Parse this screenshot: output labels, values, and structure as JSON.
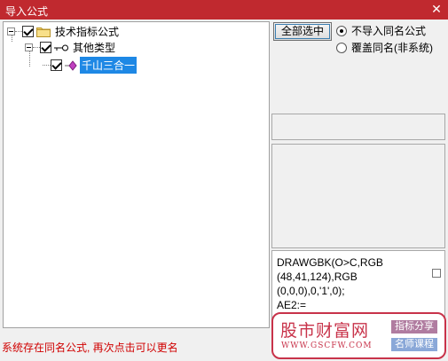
{
  "window": {
    "title": "导入公式",
    "close_glyph": "✕"
  },
  "tree": {
    "root": {
      "label": "技术指标公式",
      "checked": true,
      "icon": "folder-icon"
    },
    "child": {
      "label": "其他类型",
      "checked": true,
      "icon": "key-icon"
    },
    "leaf": {
      "label": "千山三合一",
      "checked": true,
      "selected": true,
      "icon": "formula-diamond-icon"
    }
  },
  "controls": {
    "select_all_label": "全部选中",
    "options": [
      {
        "label": "不导入同名公式",
        "selected": true
      },
      {
        "label": "覆盖同名(非系统)",
        "selected": false
      }
    ]
  },
  "code": {
    "lines": [
      "DRAWGBK(O>C,RGB",
      "(48,41,124),RGB",
      "(0,0,0),0,'1',0);",
      "AE2:="
    ]
  },
  "status": {
    "message": "系统存在同名公式, 再次点击可以更名"
  },
  "watermark": {
    "brand": "股市财富网",
    "site": "WWW.GSCFW.COM",
    "tag1": "指标分享",
    "tag2": "名师课程"
  },
  "colors": {
    "title_bar": "#c0292f",
    "selection": "#1e88e5",
    "status_text": "#d00000",
    "watermark": "#c8334a"
  }
}
